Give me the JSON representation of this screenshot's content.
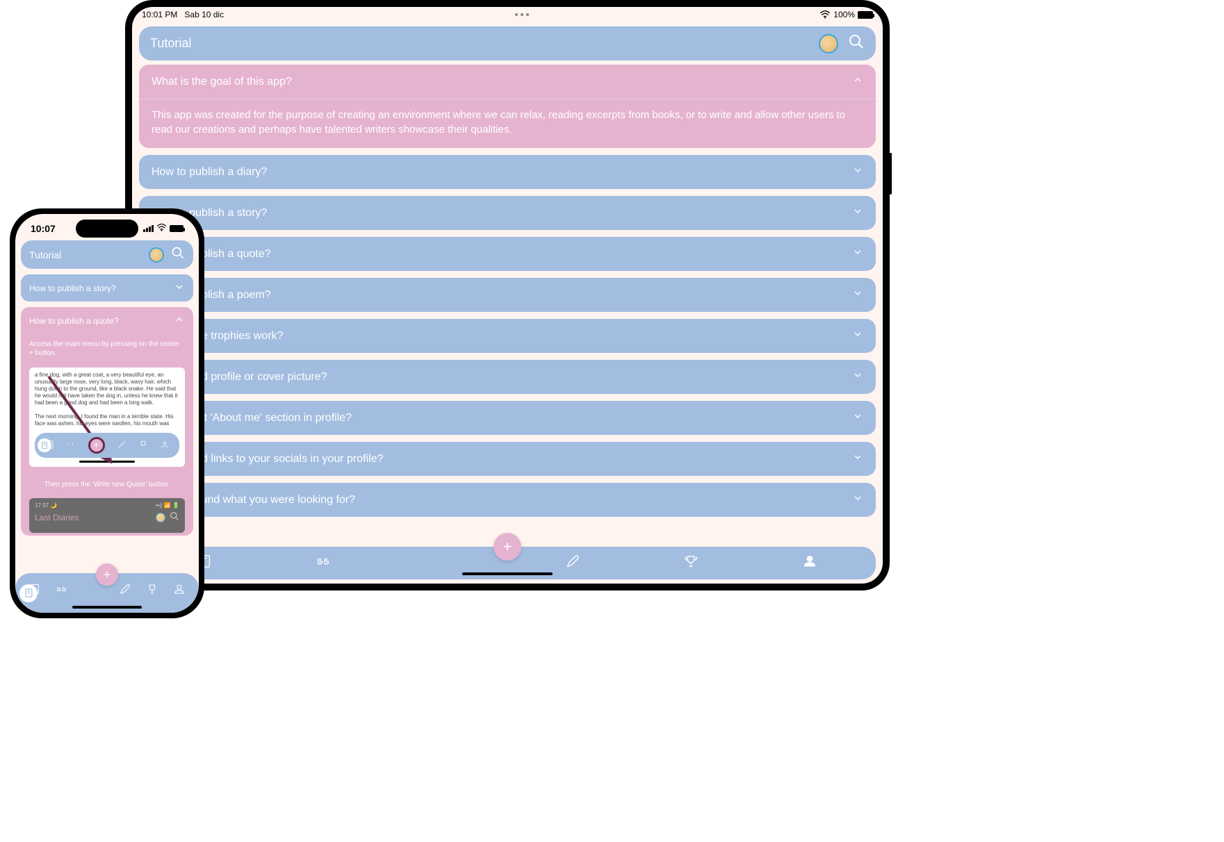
{
  "ipad": {
    "status": {
      "time": "10:01 PM",
      "date": "Sab 10 dic",
      "battery": "100%"
    },
    "header_title": "Tutorial",
    "faq_expanded": {
      "question": "What is the goal of this app?",
      "answer": "This app was created for the purpose of creating an environment where we can relax, reading excerpts from books, or to write and allow other users to read our creations and perhaps have talented writers showcase their qualities."
    },
    "faq": [
      "How to publish a diary?",
      "How to publish a story?",
      "How to publish a quote?",
      "How to publish a poem?",
      "How do the trophies work?",
      "How to add profile or cover picture?",
      "How to edit 'About me' section in profile?",
      "How to add links to your socials in your profile?",
      "Haven't found what you were looking for?"
    ],
    "fab": "+"
  },
  "iphone": {
    "status": {
      "time": "10:07"
    },
    "header_title": "Tutorial",
    "faq_collapsed": "How to publish a story?",
    "faq_expanded_q": "How to publish a quote?",
    "faq_expanded_step1": "Access the main menu by pressing on the center + button.",
    "shot_text": "a fine dog, with a great coat, a very beautiful eye, an unusually large nose, very long, black, wavy hair, which hung down to the ground, like a black snake. He said that he would not have taken the dog in, unless he knew that it had been a good dog and had been a long walk.\n\nThe next morning, I found the man in a terrible state. His face was ashen, his eyes were swollen, his mouth was",
    "shot_fab": "+",
    "faq_expanded_step2": "Then press the 'Write new Quote' button.",
    "shot2_time": "17:37",
    "shot2_title": "Last Diaries",
    "fab": "+"
  }
}
